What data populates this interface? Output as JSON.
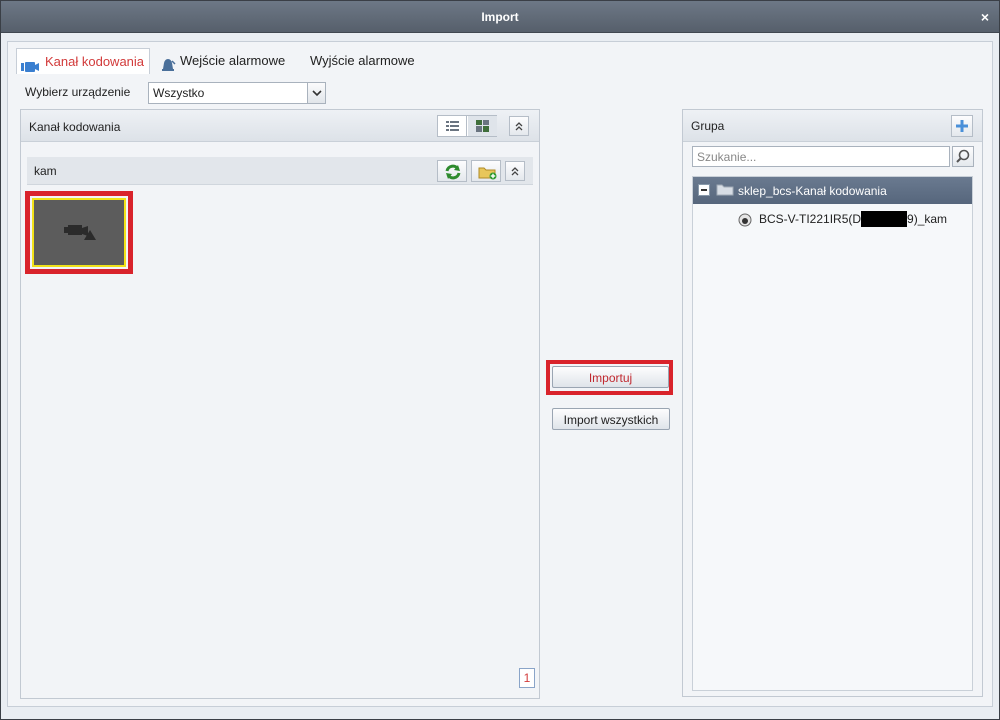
{
  "window": {
    "title": "Import",
    "close_label": "×"
  },
  "tabs": [
    {
      "label": "Kanał kodowania",
      "active": true
    },
    {
      "label": "Wejście alarmowe",
      "active": false
    },
    {
      "label": "Wyjście alarmowe",
      "active": false
    }
  ],
  "device": {
    "label": "Wybierz urządzenie",
    "selected": "Wszystko"
  },
  "left_panel": {
    "title": "Kanał kodowania",
    "group_name": "kam",
    "page": "1"
  },
  "actions": {
    "import_label": "Importuj",
    "import_all_label": "Import wszystkich"
  },
  "right_panel": {
    "title": "Grupa",
    "search_placeholder": "Szukanie...",
    "tree": {
      "root_label": "sklep_bcs-Kanał kodowania",
      "child_prefix": "BCS-V-TI221IR5(D",
      "child_suffix": "9)_kam"
    }
  },
  "colors": {
    "highlight": "#d9232b",
    "active_tab": "#d23a3a",
    "thumb_border": "#f1e21a"
  }
}
